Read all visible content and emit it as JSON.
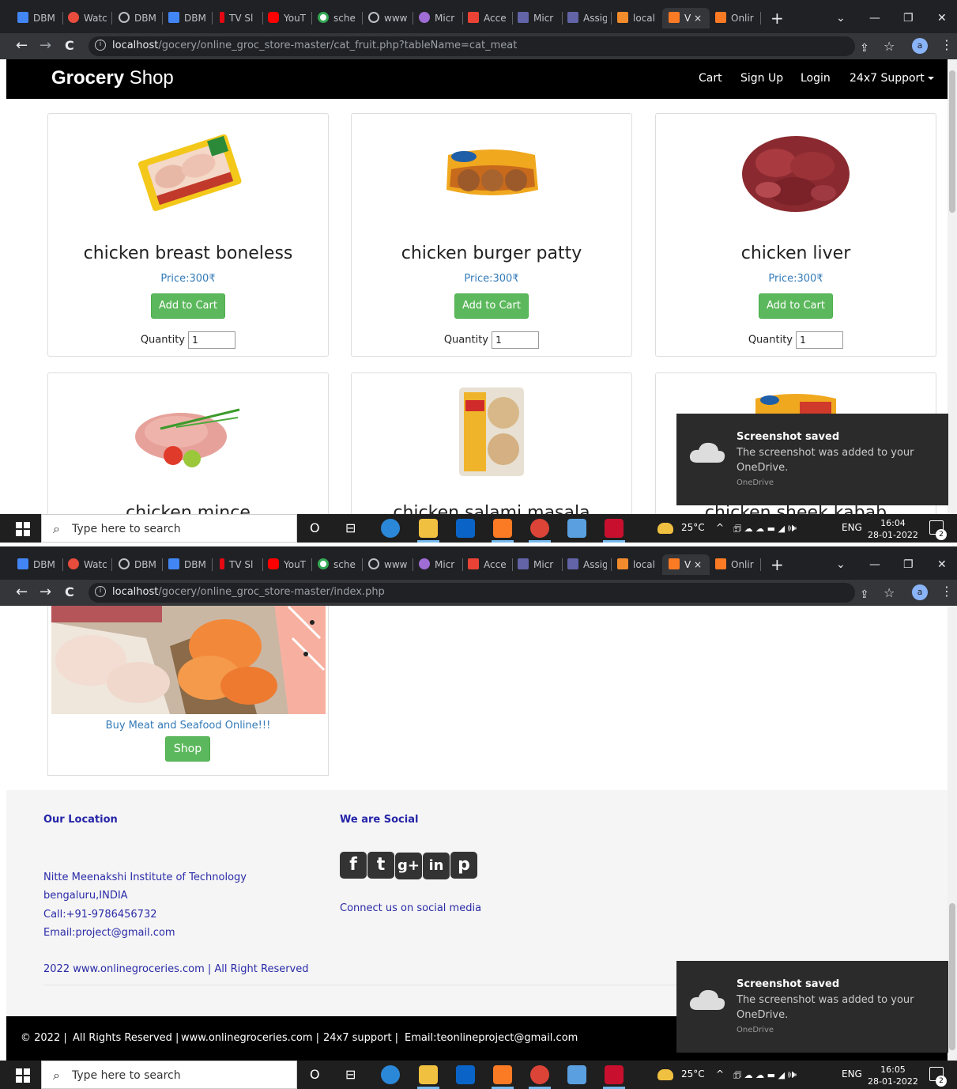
{
  "browser": {
    "tabs": [
      "DBM",
      "Watc",
      "DBM",
      "DBM",
      "TV Sl",
      "YouT",
      "sche",
      "www",
      "Micr",
      "Acce",
      "Micr",
      "Assig",
      "local",
      "V",
      "Onlir"
    ],
    "close_glyph": "×",
    "new_tab_glyph": "+",
    "minimize_glyph": "—",
    "restore_glyph": "❐",
    "window_close_glyph": "✕",
    "dropdown_glyph": "⌄",
    "back_glyph": "←",
    "forward_glyph": "→",
    "reload_glyph": "C",
    "share_glyph": "⇪",
    "bookmark_glyph": "☆",
    "avatar_letter": "a",
    "menu_glyph": "⋮",
    "info_glyph": "i"
  },
  "screens": [
    {
      "url_host": "localhost",
      "url_path": "/gocery/online_groc_store-master/cat_fruit.php?tableName=cat_meat",
      "clock_time": "16:04",
      "clock_date": "28-01-2022"
    },
    {
      "url_host": "localhost",
      "url_path": "/gocery/online_groc_store-master/index.php",
      "clock_time": "16:05",
      "clock_date": "28-01-2022"
    }
  ],
  "navbar": {
    "brand_bold": "Grocery",
    "brand_rest": " Shop",
    "links": [
      "Cart",
      "Sign Up",
      "Login",
      "24x7 Support"
    ]
  },
  "products": [
    {
      "name": "chicken breast boneless",
      "price": "Price:300₹",
      "button": "Add to Cart",
      "qty_label": "Quantity",
      "qty": "1"
    },
    {
      "name": "chicken burger patty",
      "price": "Price:300₹",
      "button": "Add to Cart",
      "qty_label": "Quantity",
      "qty": "1"
    },
    {
      "name": "chicken liver",
      "price": "Price:300₹",
      "button": "Add to Cart",
      "qty_label": "Quantity",
      "qty": "1"
    },
    {
      "name": "chicken mince"
    },
    {
      "name": "chicken salami masala"
    },
    {
      "name": "chicken sheek kabab"
    }
  ],
  "toast": {
    "title": "Screenshot saved",
    "body": "The screenshot was added to your OneDrive.",
    "source": "OneDrive"
  },
  "taskbar": {
    "search_placeholder": "Type here to search",
    "search_glyph": "⌕",
    "taskview_glyph": "O",
    "widgets_glyph": "⊟",
    "weather": "25°C",
    "tray_chevron": "^",
    "tray_icons": "🗊 ☁ ☁ ▬ ◢ 🕪",
    "language": "ENG",
    "notification_count": "2"
  },
  "category_card": {
    "caption": "Buy Meat and Seafood Online!!!",
    "button": "Shop"
  },
  "footer": {
    "location_heading": "Our Location",
    "social_heading": "We are Social",
    "address_lines": [
      "Nitte Meenakshi Institute of Technology",
      "bengaluru,INDIA",
      "Call:+91-9786456732",
      "Email:project@gmail.com"
    ],
    "copyright": "2022 www.onlinegroceries.com | All Right Reserved",
    "social_glyphs": [
      "f",
      "t",
      "g+",
      "in",
      "p"
    ],
    "social_caption": "Connect us on social media",
    "bottom_items": [
      "© 2022 |",
      "All Rights Reserved |",
      "www.onlinegroceries.com |",
      "24x7 support |",
      "Email:teonlineproject@gmail.com"
    ]
  }
}
